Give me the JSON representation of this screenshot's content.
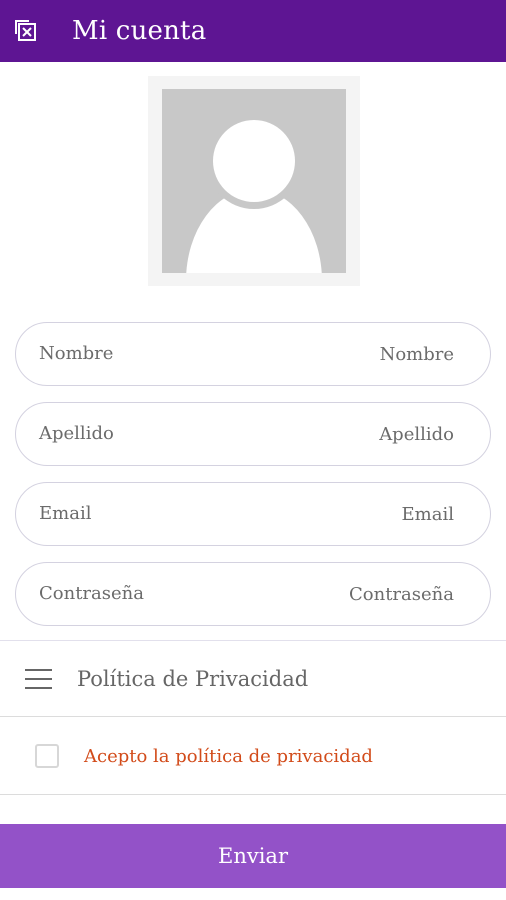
{
  "appbar": {
    "title": "Mi cuenta",
    "back_icon": "exit-icon",
    "background": "#5e1593"
  },
  "form": {
    "fields": [
      {
        "label": "Nombre",
        "placeholder": "Nombre"
      },
      {
        "label": "Apellido",
        "placeholder": "Apellido"
      },
      {
        "label": "Email",
        "placeholder": "Email"
      },
      {
        "label": "Contraseña",
        "placeholder": "Contraseña"
      }
    ]
  },
  "policy": {
    "menu_icon": "menu-icon",
    "label": "Política de Privacidad"
  },
  "accept": {
    "label": "Acepto la política de privacidad",
    "checked": false,
    "color": "#d24b1a"
  },
  "submit": {
    "label": "Enviar",
    "background": "#9352c8"
  }
}
